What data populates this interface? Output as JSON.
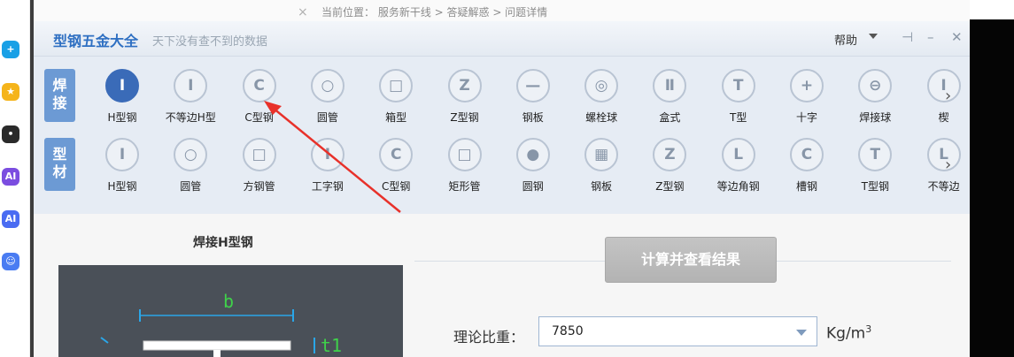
{
  "breadcrumb": {
    "close_glyph": "×",
    "text": "当前位置： 服务新干线 > 答疑解惑 > 问题详情"
  },
  "sidebar_icons": [
    {
      "name": "plus-app-icon",
      "color": "#19a0e6",
      "glyph": "+"
    },
    {
      "name": "star-app-icon",
      "color": "#f5b41b",
      "glyph": "★"
    },
    {
      "name": "chat-app-icon",
      "color": "#2a2a2a",
      "glyph": "•"
    },
    {
      "name": "ai-app-icon",
      "color": "#7b4de0",
      "glyph": "AI"
    },
    {
      "name": "ai-assistant-icon",
      "color": "#4a6cf2",
      "glyph": "AI"
    },
    {
      "name": "bot-app-icon",
      "color": "#4a7cf2",
      "glyph": "☺"
    }
  ],
  "window": {
    "title": "型钢五金大全",
    "subtitle": "天下没有查不到的数据",
    "help_label": "帮助",
    "controls": {
      "pin": "⊣",
      "minimize": "–",
      "close": "✕"
    }
  },
  "categories": [
    {
      "label_top": "焊",
      "label_bottom": "接"
    },
    {
      "label_top": "型",
      "label_bottom": "材"
    }
  ],
  "welded_items": [
    {
      "label": "H型钢",
      "glyph": "I",
      "selected": true
    },
    {
      "label": "不等边H型",
      "glyph": "I",
      "selected": false
    },
    {
      "label": "C型钢",
      "glyph": "C",
      "selected": false
    },
    {
      "label": "圆管",
      "glyph": "○",
      "selected": false
    },
    {
      "label": "箱型",
      "glyph": "□",
      "selected": false
    },
    {
      "label": "Z型钢",
      "glyph": "Z",
      "selected": false
    },
    {
      "label": "钢板",
      "glyph": "—",
      "selected": false
    },
    {
      "label": "螺栓球",
      "glyph": "◎",
      "selected": false
    },
    {
      "label": "盒式",
      "glyph": "Ⅱ",
      "selected": false
    },
    {
      "label": "T型",
      "glyph": "T",
      "selected": false
    },
    {
      "label": "十字",
      "glyph": "+",
      "selected": false
    },
    {
      "label": "焊接球",
      "glyph": "⊖",
      "selected": false
    },
    {
      "label": "楔",
      "glyph": "I",
      "selected": false
    }
  ],
  "profile_items": [
    {
      "label": "H型钢",
      "glyph": "I"
    },
    {
      "label": "圆管",
      "glyph": "○"
    },
    {
      "label": "方钢管",
      "glyph": "□"
    },
    {
      "label": "工字钢",
      "glyph": "I"
    },
    {
      "label": "C型钢",
      "glyph": "C"
    },
    {
      "label": "矩形管",
      "glyph": "□"
    },
    {
      "label": "圆钢",
      "glyph": "●"
    },
    {
      "label": "钢板",
      "glyph": "▦"
    },
    {
      "label": "Z型钢",
      "glyph": "Z"
    },
    {
      "label": "等边角钢",
      "glyph": "L"
    },
    {
      "label": "槽钢",
      "glyph": "C"
    },
    {
      "label": "T型钢",
      "glyph": "T"
    },
    {
      "label": "不等边",
      "glyph": "L"
    }
  ],
  "more_glyph": "›",
  "content": {
    "section_title": "焊接H型钢",
    "calc_button": "计算并查看结果",
    "density_label": "理论比重：",
    "density_value": "7850",
    "unit_base": "Kg/m",
    "unit_exp": "3",
    "diagram": {
      "dim_b": "b",
      "dim_t1": "t1"
    }
  },
  "accent_colors": {
    "selected": "#3a6bb8",
    "category": "#6c9ad4",
    "arrow": "#e8312a"
  }
}
